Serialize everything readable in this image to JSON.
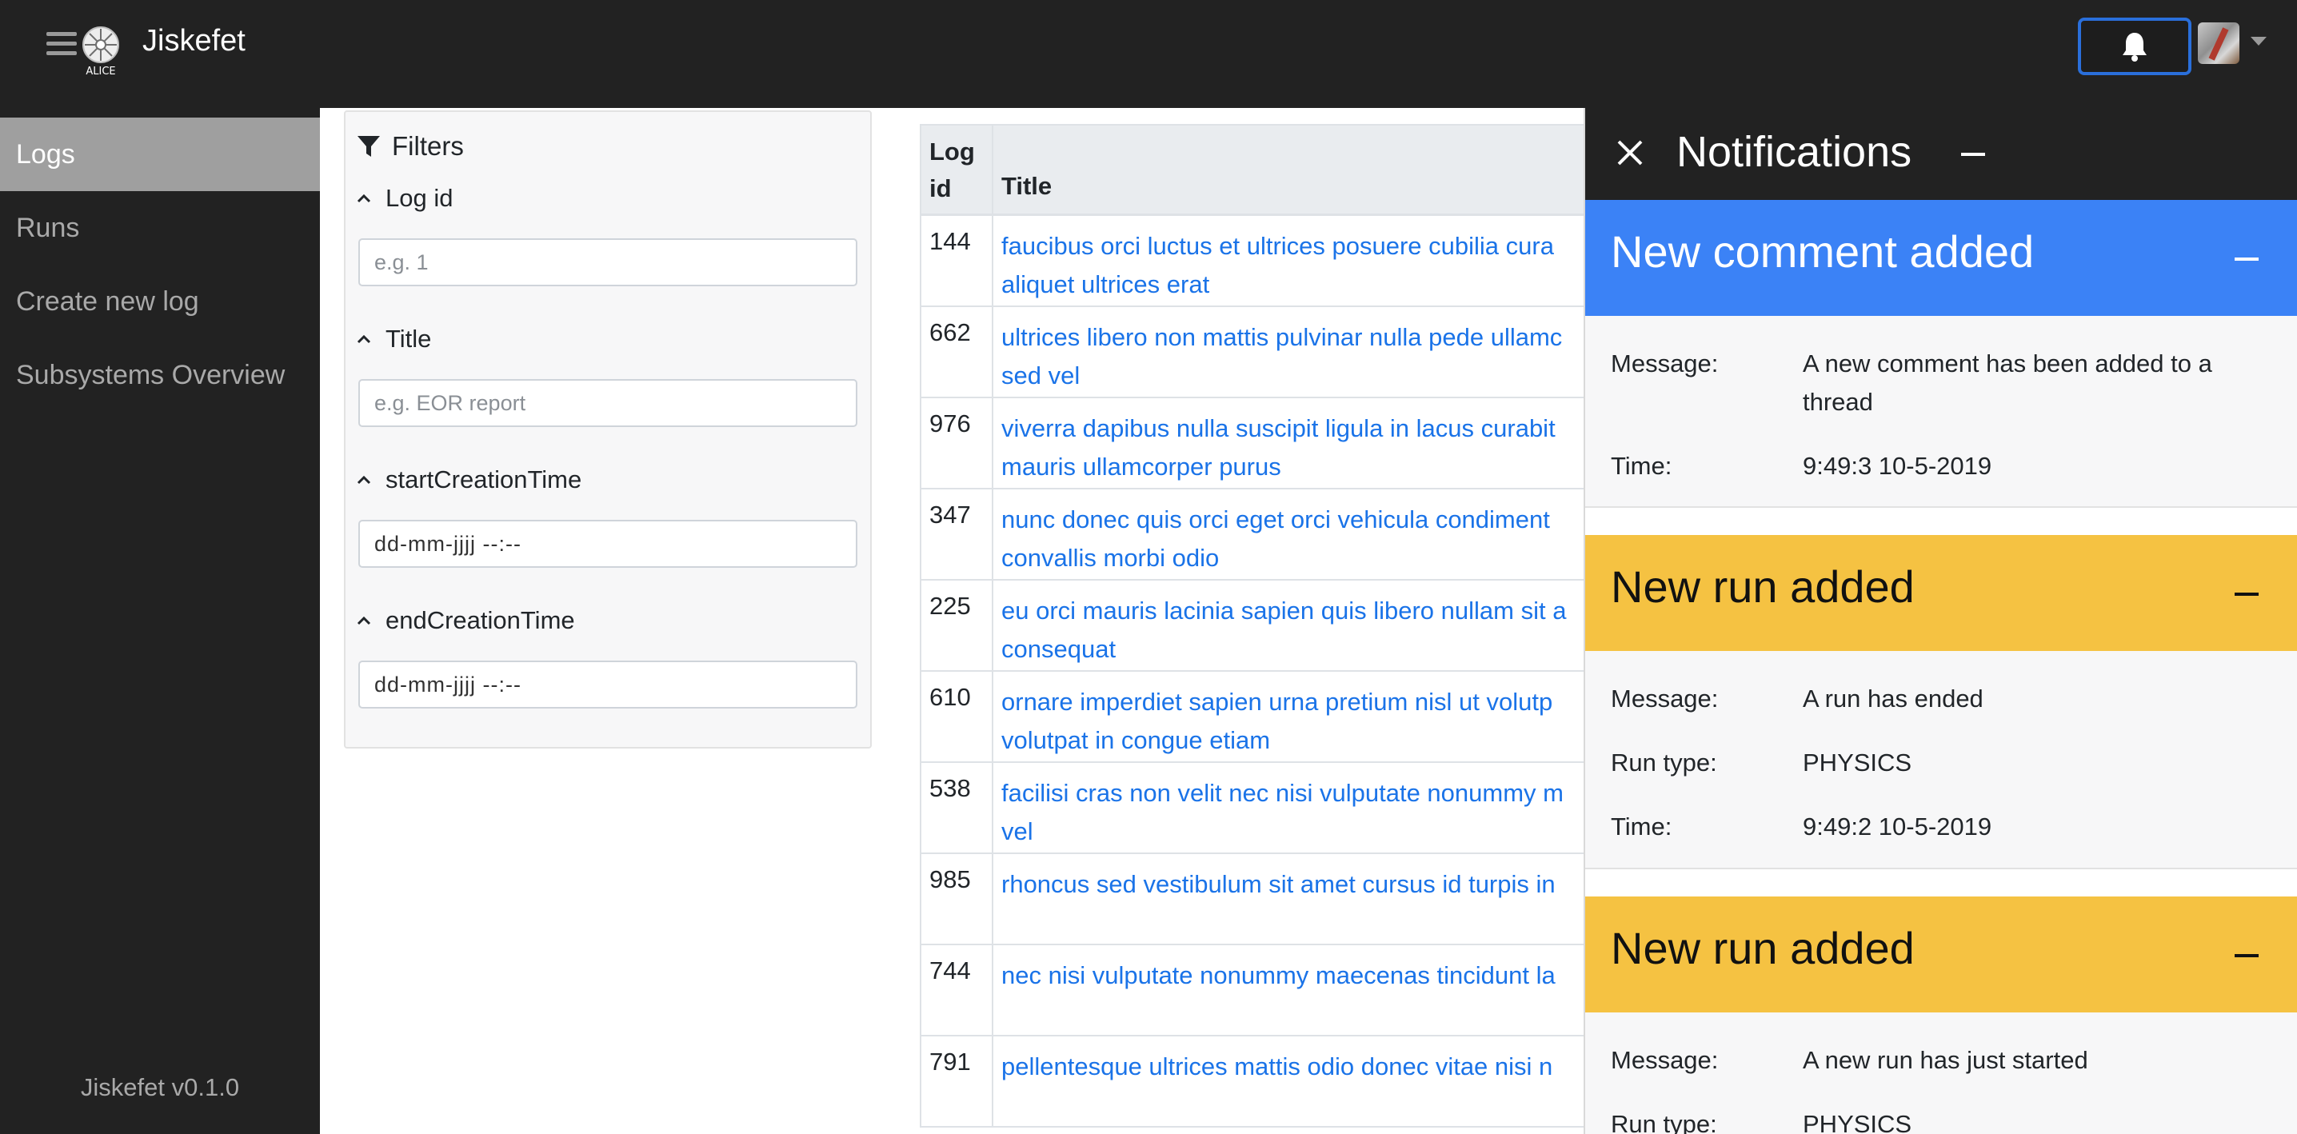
{
  "app": {
    "name": "Jiskefet",
    "logo_text": "ALICE",
    "version": "Jiskefet v0.1.0"
  },
  "sidebar": {
    "items": [
      {
        "label": "Logs",
        "active": true
      },
      {
        "label": "Runs",
        "active": false
      },
      {
        "label": "Create new log",
        "active": false
      },
      {
        "label": "Subsystems Overview",
        "active": false
      }
    ]
  },
  "filters": {
    "title": "Filters",
    "log_id": {
      "label": "Log id",
      "placeholder": "e.g. 1"
    },
    "title_field": {
      "label": "Title",
      "placeholder": "e.g. EOR report"
    },
    "start": {
      "label": "startCreationTime",
      "value": "dd-mm-jjjj --:--"
    },
    "end": {
      "label": "endCreationTime",
      "value": "dd-mm-jjjj --:--"
    }
  },
  "table": {
    "headers": {
      "id": "Log id",
      "title": "Title"
    },
    "rows": [
      {
        "id": "144",
        "title": "faucibus orci luctus et ultrices posuere cubilia cura",
        "title2": "aliquet ultrices erat"
      },
      {
        "id": "662",
        "title": "ultrices libero non mattis pulvinar nulla pede ullamc",
        "title2": "sed vel"
      },
      {
        "id": "976",
        "title": "viverra dapibus nulla suscipit ligula in lacus curabit",
        "title2": "mauris ullamcorper purus"
      },
      {
        "id": "347",
        "title": "nunc donec quis orci eget orci vehicula condiment",
        "title2": "convallis morbi odio"
      },
      {
        "id": "225",
        "title": "eu orci mauris lacinia sapien quis libero nullam sit a",
        "title2": "consequat"
      },
      {
        "id": "610",
        "title": "ornare imperdiet sapien urna pretium nisl ut volutp",
        "title2": "volutpat in congue etiam"
      },
      {
        "id": "538",
        "title": "facilisi cras non velit nec nisi vulputate nonummy m",
        "title2": "vel"
      },
      {
        "id": "985",
        "title": "rhoncus sed vestibulum sit amet cursus id turpis in",
        "title2": ""
      },
      {
        "id": "744",
        "title": "nec nisi vulputate nonummy maecenas tincidunt la",
        "title2": ""
      },
      {
        "id": "791",
        "title": "pellentesque ultrices mattis odio donec vitae nisi n",
        "title2": ""
      }
    ]
  },
  "notifications": {
    "title": "Notifications",
    "cards": [
      {
        "title": "New comment added",
        "color": "#3b82f6",
        "message_label": "Message:",
        "message": "A new comment has been added to a thread",
        "time_label": "Time:",
        "time": "9:49:3 10-5-2019"
      },
      {
        "title": "New run added",
        "color": "#f5c242",
        "message_label": "Message:",
        "message": "A run has ended",
        "run_type_label": "Run type:",
        "run_type": "PHYSICS",
        "time_label": "Time:",
        "time": "9:49:2 10-5-2019"
      },
      {
        "title": "New run added",
        "color": "#f5c242",
        "message_label": "Message:",
        "message": "A new run has just started",
        "run_type_label": "Run type:",
        "run_type": "PHYSICS"
      }
    ]
  },
  "colors": {
    "navbar": "#222222",
    "link": "#1a73e8",
    "info": "#3b82f6",
    "warning": "#f5c242"
  }
}
